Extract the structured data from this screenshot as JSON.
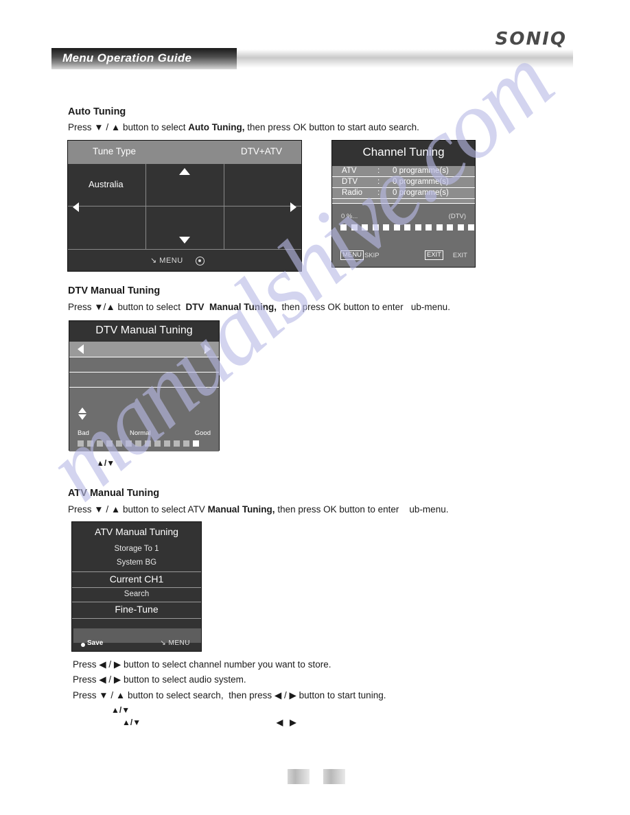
{
  "header": {
    "brand": "SONIQ",
    "title": "Menu Operation Guide"
  },
  "sections": [
    {
      "heading": "Auto Tuning",
      "instruction_prefix": "Press ▼ / ▲ button to select ",
      "instruction_bold": "Auto Tuning,",
      "instruction_suffix": " then press OK button to start auto search."
    },
    {
      "heading": "DTV Manual Tuning",
      "instruction_prefix": "Press ▼/▲ button to select  ",
      "instruction_bold": "DTV  Manual Tuning,",
      "instruction_suffix": "  then press OK button to enter   ub-menu."
    },
    {
      "heading": "ATV Manual Tuning",
      "instruction_prefix": "Press ▼ / ▲ button to select ATV ",
      "instruction_bold": "Manual Tuning,",
      "instruction_suffix": " then press OK button to enter    ub-menu."
    }
  ],
  "tune_type_osd": {
    "label": "Tune Type",
    "value": "DTV+ATV",
    "country": "Australia",
    "footer_menu": "MENU",
    "icons": {
      "up": "triangle-up-icon",
      "down": "triangle-down-icon",
      "left": "triangle-left-icon",
      "right": "triangle-right-icon",
      "ok": "ok-circle-icon",
      "menu_return": "return-arrow-icon"
    }
  },
  "channel_tuning_osd": {
    "title": "Channel Tuning",
    "rows": [
      {
        "key": "ATV",
        "colon": ":",
        "value": "0 programme(s)"
      },
      {
        "key": "DTV",
        "colon": ":",
        "value": "0 programme(s)"
      },
      {
        "key": "Radio",
        "colon": ":",
        "value": "0 programme(s)"
      }
    ],
    "percent": "0 %...",
    "mode": "(DTV)",
    "progress_blocks": 13,
    "menu_key": "MENU",
    "skip_label": "SKIP",
    "exit_key": "EXIT",
    "exit_label": "EXIT"
  },
  "dtv_manual_osd": {
    "title": "DTV Manual Tuning",
    "scale": {
      "bad": "Bad",
      "normal": "Normal",
      "good": "Good"
    },
    "bars_total": 13,
    "bars_on": 1,
    "rows_blank": 3
  },
  "dtv_note": "▲/▼",
  "atv_manual_osd": {
    "title": "ATV Manual Tuning",
    "items": [
      "Storage To 1",
      "System BG",
      "Current CH1",
      "Search",
      "Fine-Tune"
    ],
    "save_label": "Save",
    "menu_label": "MENU"
  },
  "atv_instructions": [
    "Press ◀ / ▶ button to select channel number you want to store.",
    "Press ◀ / ▶ button to select audio system.",
    "Press ▼ / ▲ button to select search,  then press ◀ / ▶ button to start tuning."
  ],
  "atv_notes": [
    "▲/▼",
    "▲/▼",
    "◀   ▶"
  ],
  "watermark": "manualshive.com",
  "colors": {
    "osd_dark": "#333333",
    "osd_mid": "#6e6e6e",
    "osd_header": "#8b8b8b",
    "text": "#1a1a1a",
    "watermark": "#b9bbe6"
  }
}
